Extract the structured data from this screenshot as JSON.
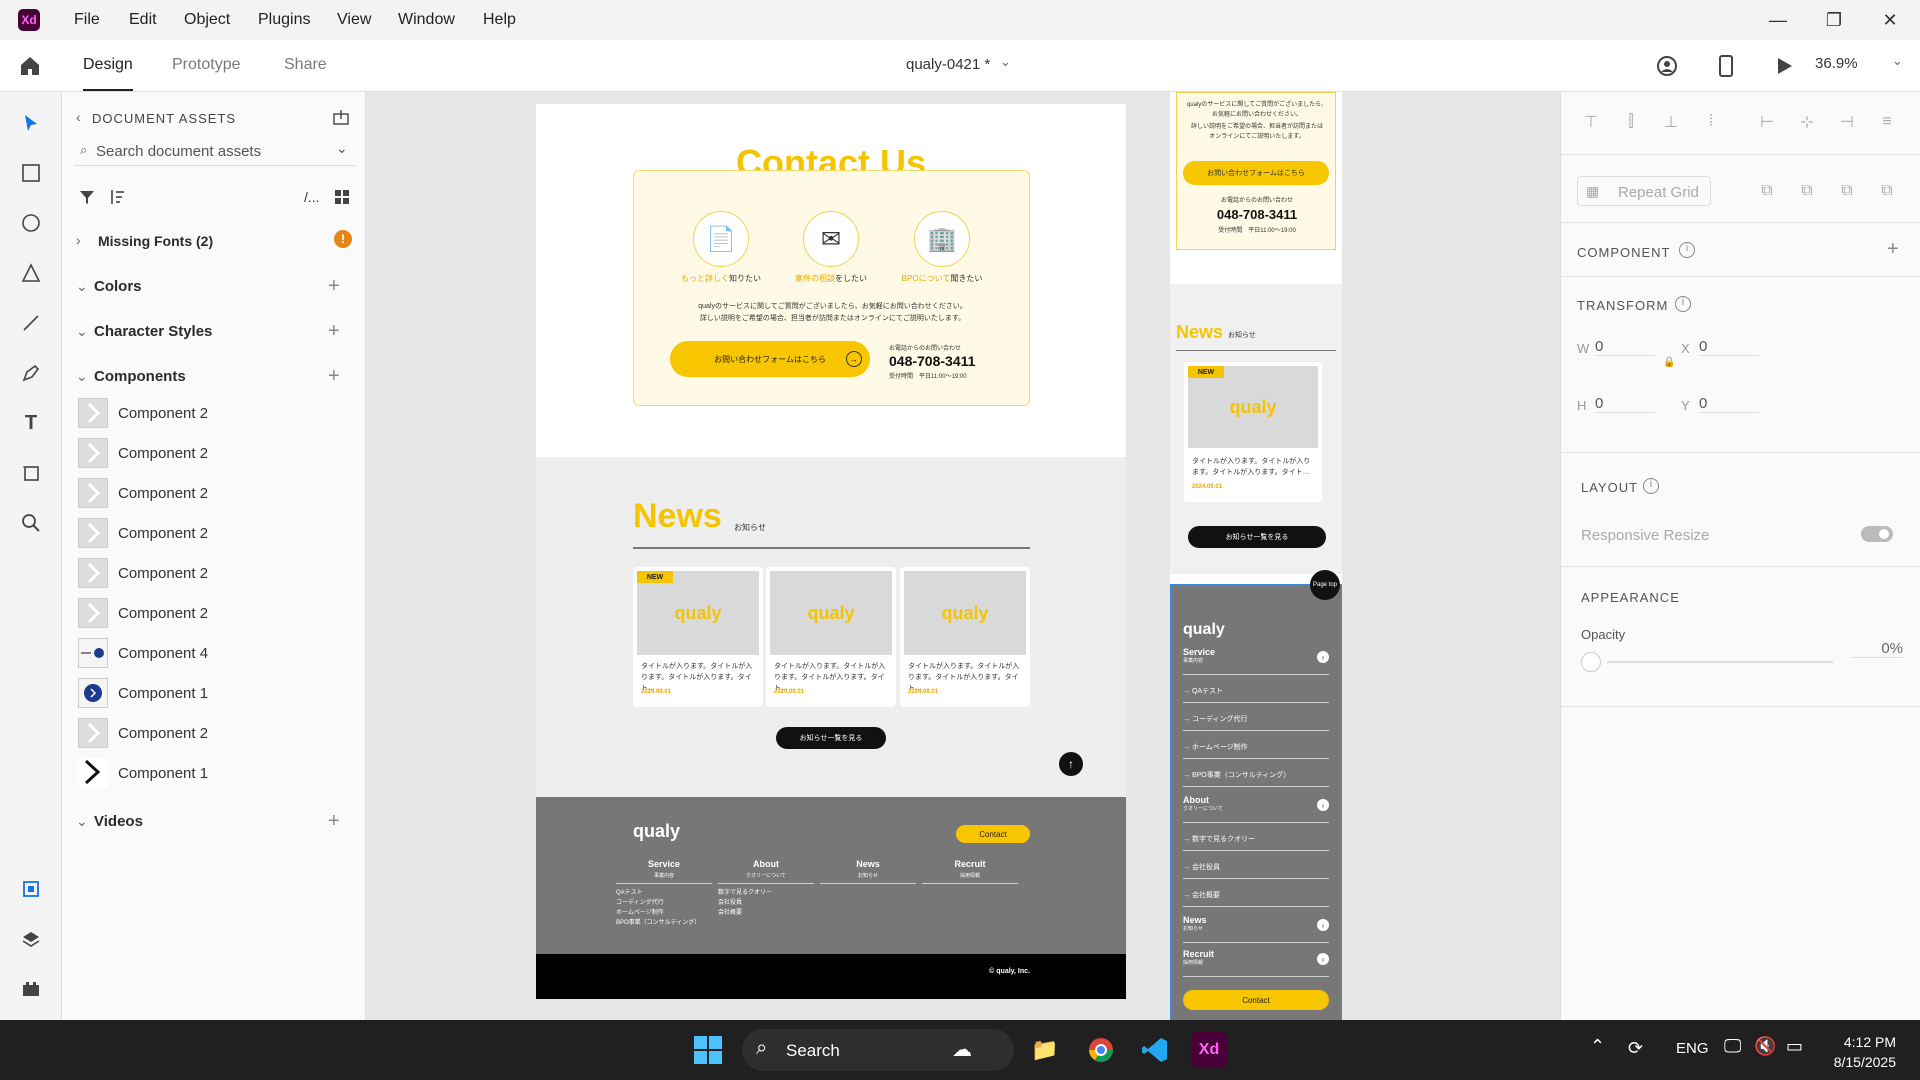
{
  "app": {
    "logo": "Xd",
    "menu": [
      "File",
      "Edit",
      "Object",
      "Plugins",
      "View",
      "Window",
      "Help"
    ]
  },
  "tabs": {
    "design": "Design",
    "prototype": "Prototype",
    "share": "Share",
    "document_title": "qualy-0421 *",
    "zoom": "36.9%"
  },
  "assets": {
    "header": "DOCUMENT ASSETS",
    "search_placeholder": "Search document assets",
    "view_toggle": "/...",
    "missing_fonts": "Missing Fonts (2)",
    "warning_badge": "!",
    "sections": {
      "colors": "Colors",
      "character_styles": "Character Styles",
      "components": "Components",
      "videos": "Videos"
    },
    "components": [
      "Component 2",
      "Component 2",
      "Component 2",
      "Component 2",
      "Component 2",
      "Component 2",
      "Component 4",
      "Component 1",
      "Component 2",
      "Component 1"
    ]
  },
  "artboard1": {
    "contact_title": "Contact Us",
    "icon_labels": [
      {
        "hl": "もっと詳しく",
        "rest": "知りたい"
      },
      {
        "hl": "案件の相談",
        "rest": "をしたい"
      },
      {
        "hl": "BPOについて",
        "rest": "聞きたい"
      }
    ],
    "desc1": "qualyのサービスに関してご質問がございましたら、お気軽にお問い合わせください。",
    "desc2": "詳しい説明をご希望の場合、担当者が訪問またはオンラインにてご説明いたします。",
    "form_button": "お問い合わせフォームはこちら",
    "phone_caption": "お電話からのお問い合わせ",
    "phone": "048-708-3411",
    "phone_hours": "受付時間　平日11:00～19:00",
    "news_title": "News",
    "news_sub": "お知らせ",
    "news_cards": [
      {
        "badge": "NEW",
        "logo": "qualy",
        "text": "タイトルが入ります。タイトルが入ります。タイトルが入ります。タイト…",
        "date": "2024.09.01"
      },
      {
        "badge": "",
        "logo": "qualy",
        "text": "タイトルが入ります。タイトルが入ります。タイトルが入ります。タイト…",
        "date": "2024.09.01"
      },
      {
        "badge": "",
        "logo": "qualy",
        "text": "タイトルが入ります。タイトルが入ります。タイトルが入ります。タイト…",
        "date": "2024.09.01"
      }
    ],
    "news_more": "お知らせ一覧を見る",
    "footer_logo": "qualy",
    "footer_contact": "Contact",
    "footer_cols": [
      {
        "head": "Service",
        "sub": "事業内容",
        "links": [
          "QAテスト",
          "コーディング代行",
          "ホームページ制作",
          "BPO事業（コンサルティング）"
        ]
      },
      {
        "head": "About",
        "sub": "クオリーについて",
        "links": [
          "数字で見るクオリー",
          "会社役員",
          "会社概要"
        ]
      },
      {
        "head": "News",
        "sub": "お知らせ",
        "links": []
      },
      {
        "head": "Recruit",
        "sub": "採用情報",
        "links": []
      }
    ],
    "copyright": "© qualy, Inc."
  },
  "artboard2": {
    "desc1": "qualyのサービスに関してご質問がございましたら、",
    "desc2": "お気軽にお問い合わせください。",
    "desc3": "詳しい説明をご希望の場合、担当者が訪問または",
    "desc4": "オンラインにてご説明いたします。",
    "form_button": "お問い合わせフォームはこちら",
    "phone_caption": "お電話からのお問い合わせ",
    "phone": "048-708-3411",
    "phone_hours": "受付時間　平日11:00～19:00",
    "news_title": "News",
    "news_sub": "お知らせ",
    "news_badge": "NEW",
    "news_logo": "qualy",
    "news_text": "タイトルが入ります。タイトルが入ります。タイトルが入ります。タイト…",
    "news_date": "2024.09.01",
    "news_more": "お知らせ一覧を見る",
    "pagetop": "Page top",
    "footer_logo": "qualy",
    "footer_rows": [
      {
        "label": "Service",
        "sub": "事業内容",
        "head": true
      },
      {
        "label": "→ QAテスト",
        "sub": "",
        "head": false
      },
      {
        "label": "→ コーディング代行",
        "sub": "",
        "head": false
      },
      {
        "label": "→ ホームページ制作",
        "sub": "",
        "head": false
      },
      {
        "label": "→ BPO事業（コンサルティング）",
        "sub": "",
        "head": false
      },
      {
        "label": "About",
        "sub": "クオリーについて",
        "head": true
      },
      {
        "label": "→ 数字で見るクオリー",
        "sub": "",
        "head": false
      },
      {
        "label": "→ 会社役員",
        "sub": "",
        "head": false
      },
      {
        "label": "→ 会社概要",
        "sub": "",
        "head": false
      },
      {
        "label": "News",
        "sub": "お知らせ",
        "head": true
      },
      {
        "label": "Recruit",
        "sub": "採用情報",
        "head": true
      }
    ],
    "footer_contact": "Contact"
  },
  "props": {
    "repeat_grid": "Repeat Grid",
    "component": "COMPONENT",
    "transform": "TRANSFORM",
    "w_label": "W",
    "w_value": "0",
    "x_label": "X",
    "x_value": "0",
    "h_label": "H",
    "h_value": "0",
    "y_label": "Y",
    "y_value": "0",
    "layout": "LAYOUT",
    "responsive_resize": "Responsive Resize",
    "appearance": "APPEARANCE",
    "opacity_label": "Opacity",
    "opacity_value": "0%"
  },
  "taskbar": {
    "search": "Search",
    "lang": "ENG",
    "time": "4:12 PM",
    "date": "8/15/2025"
  },
  "colors": {
    "accent_yellow": "#f5c400",
    "xd_brand": "#470137",
    "selection_blue": "#3b8be0"
  }
}
